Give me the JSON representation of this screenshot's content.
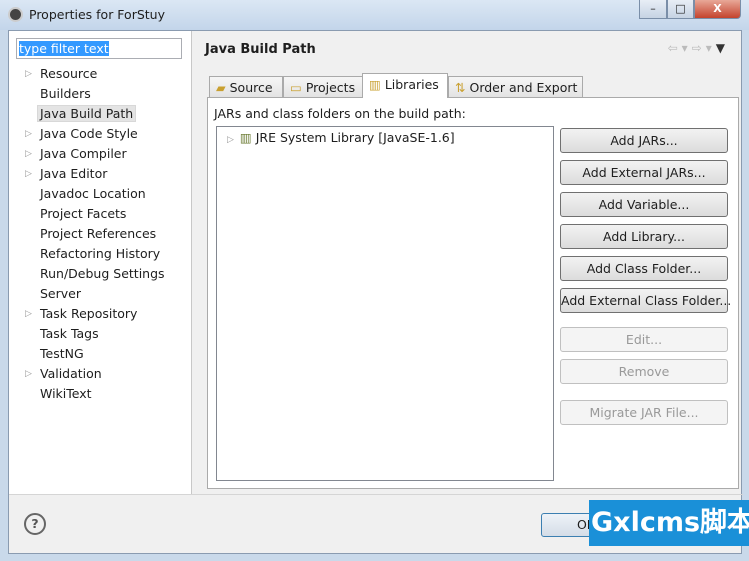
{
  "window": {
    "title": "Properties for ForStuy",
    "min": "–",
    "max": "□",
    "close": "X"
  },
  "filter": {
    "value": "type filter text"
  },
  "tree": [
    {
      "label": "Resource",
      "expandable": true
    },
    {
      "label": "Builders",
      "expandable": false
    },
    {
      "label": "Java Build Path",
      "expandable": false,
      "selected": true
    },
    {
      "label": "Java Code Style",
      "expandable": true
    },
    {
      "label": "Java Compiler",
      "expandable": true
    },
    {
      "label": "Java Editor",
      "expandable": true
    },
    {
      "label": "Javadoc Location",
      "expandable": false
    },
    {
      "label": "Project Facets",
      "expandable": false
    },
    {
      "label": "Project References",
      "expandable": false
    },
    {
      "label": "Refactoring History",
      "expandable": false
    },
    {
      "label": "Run/Debug Settings",
      "expandable": false
    },
    {
      "label": "Server",
      "expandable": false
    },
    {
      "label": "Task Repository",
      "expandable": true
    },
    {
      "label": "Task Tags",
      "expandable": false
    },
    {
      "label": "TestNG",
      "expandable": false
    },
    {
      "label": "Validation",
      "expandable": true
    },
    {
      "label": "WikiText",
      "expandable": false
    }
  ],
  "page": {
    "title": "Java Build Path",
    "nav": {
      "back": "⇦",
      "forward": "⇨",
      "drop": "▾",
      "menu": "▼"
    }
  },
  "tabs": [
    {
      "label": "Source",
      "icon": "source-folder-icon"
    },
    {
      "label": "Projects",
      "icon": "folder-icon"
    },
    {
      "label": "Libraries",
      "icon": "library-icon",
      "active": true
    },
    {
      "label": "Order and Export",
      "icon": "order-icon"
    }
  ],
  "libraries": {
    "label": "JARs and class folders on the build path:",
    "items": [
      "JRE System Library [JavaSE-1.6]"
    ]
  },
  "buttons": [
    {
      "label": "Add JARs...",
      "enabled": true
    },
    {
      "label": "Add External JARs...",
      "enabled": true
    },
    {
      "label": "Add Variable...",
      "enabled": true
    },
    {
      "label": "Add Library...",
      "enabled": true
    },
    {
      "label": "Add Class Folder...",
      "enabled": true
    },
    {
      "label": "Add External Class Folder...",
      "enabled": true
    },
    {
      "label": "Edit...",
      "enabled": false
    },
    {
      "label": "Remove",
      "enabled": false
    },
    {
      "label": "Migrate JAR File...",
      "enabled": false
    }
  ],
  "footer": {
    "help": "?",
    "ok": "OK"
  },
  "watermark": "Gxlcms脚本"
}
